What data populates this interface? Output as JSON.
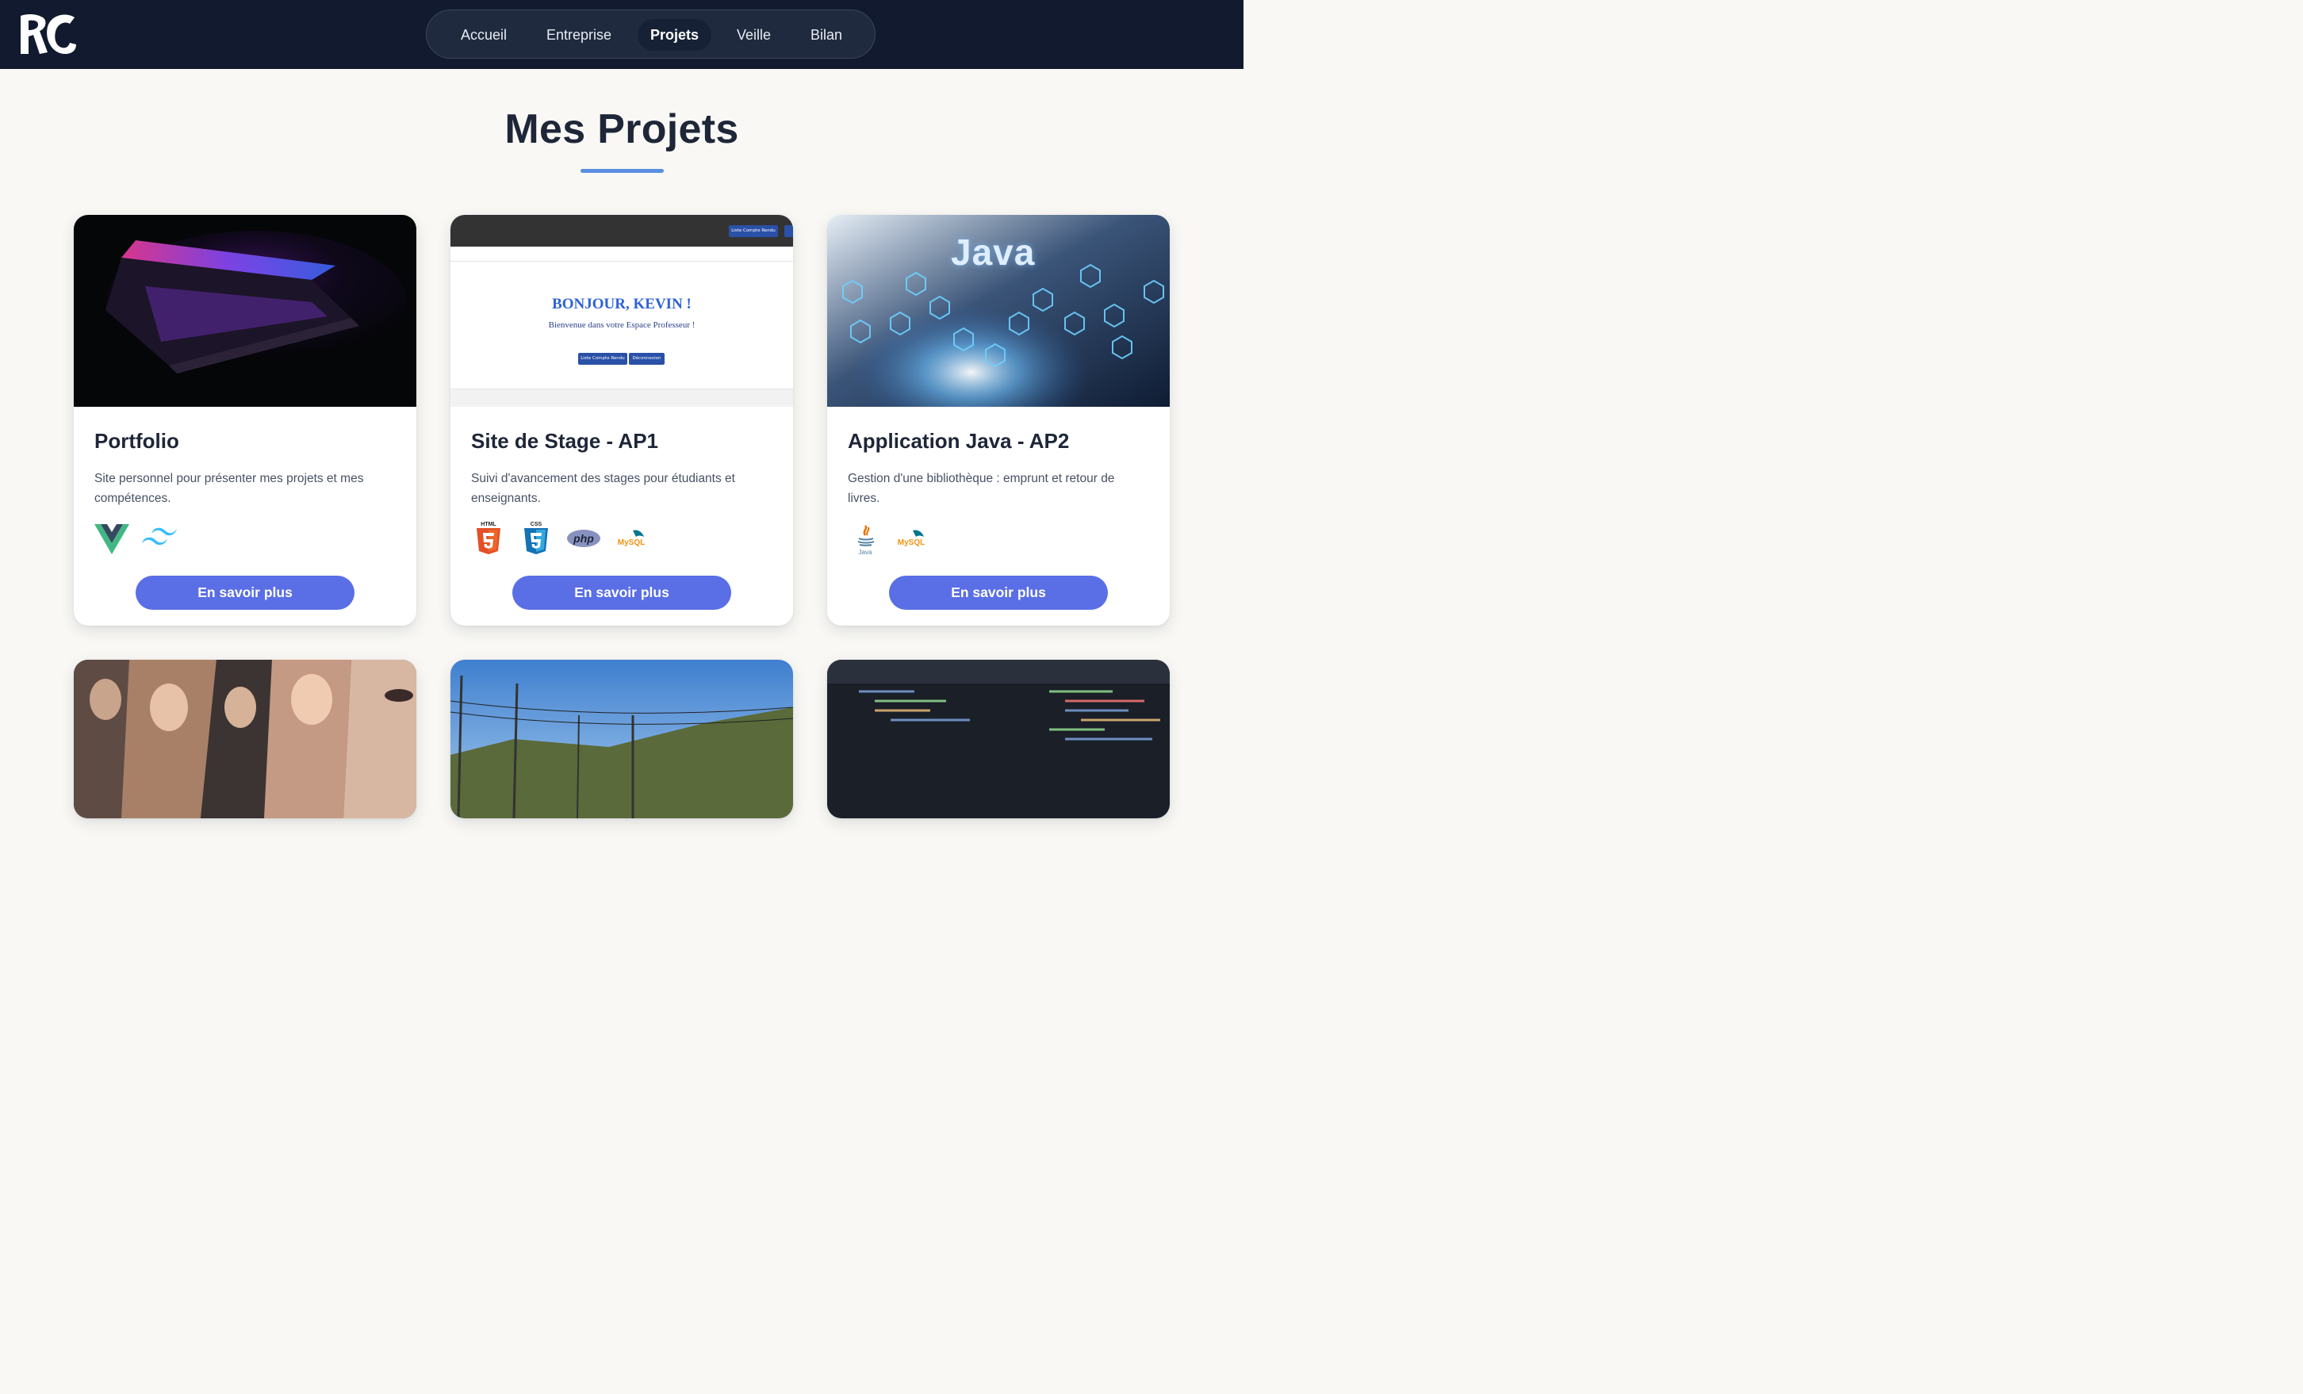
{
  "header": {
    "logo_name": "RC logo",
    "nav": [
      {
        "label": "Accueil",
        "active": false
      },
      {
        "label": "Entreprise",
        "active": false
      },
      {
        "label": "Projets",
        "active": true
      },
      {
        "label": "Veille",
        "active": false
      },
      {
        "label": "Bilan",
        "active": false
      }
    ]
  },
  "page": {
    "title": "Mes Projets",
    "accent_color": "#5b8fe0",
    "button_color": "#5a6ee5"
  },
  "projects": [
    {
      "title": "Portfolio",
      "description": "Site personnel pour présenter mes projets et mes compétences.",
      "technologies": [
        "vue-icon",
        "tailwind-icon"
      ],
      "button": "En savoir plus"
    },
    {
      "title": "Site de Stage - AP1",
      "description": "Suivi d'avancement des stages pour étudiants et enseignants.",
      "technologies": [
        "html5-icon",
        "css3-icon",
        "php-icon",
        "mysql-icon"
      ],
      "button": "En savoir plus",
      "preview": {
        "heading": "BONJOUR, KEVIN !",
        "subheading": "Bienvenue dans votre Espace Professeur !",
        "buttons": [
          "Liste Compte Rendu",
          "Déconnexion"
        ]
      }
    },
    {
      "title": "Application Java - AP2",
      "description": "Gestion d'une bibliothèque : emprunt et retour de livres.",
      "technologies": [
        "java-icon",
        "mysql-icon"
      ],
      "button": "En savoir plus",
      "preview": {
        "heading": "Java"
      }
    }
  ],
  "tech_labels": {
    "html": "HTML",
    "css": "CSS",
    "php": "php",
    "mysql": "MySQL",
    "java": "Java"
  }
}
